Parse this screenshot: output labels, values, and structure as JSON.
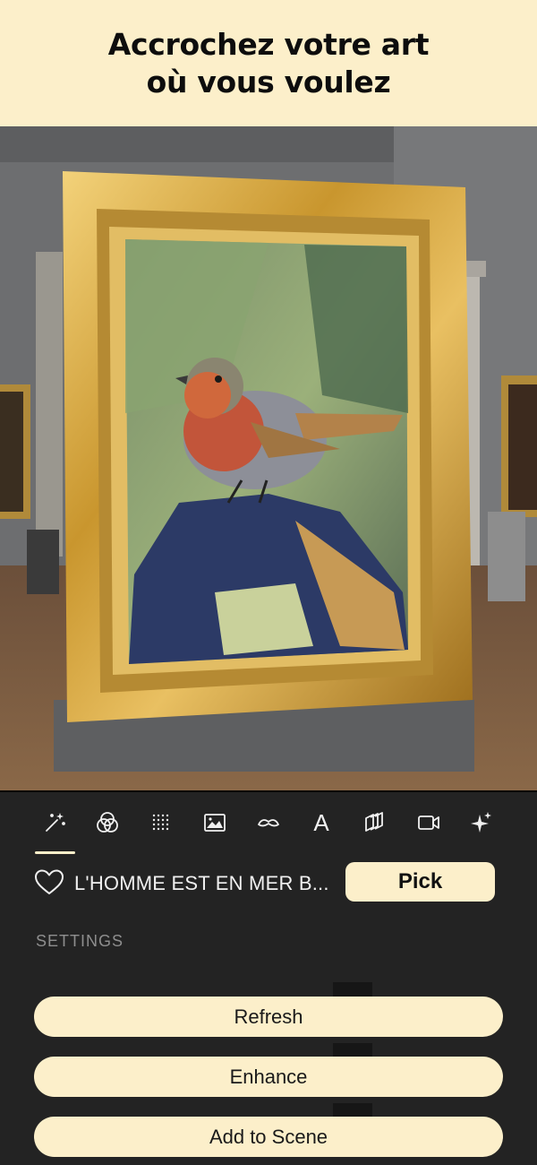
{
  "banner": {
    "line1": "Accrochez votre art",
    "line2": "où vous voulez",
    "background": "#fcefca"
  },
  "scene": {
    "image": "bird-painting-in-gold-frame-museum"
  },
  "toolbar": {
    "items": [
      {
        "icon": "magic-wand-icon",
        "selected": true
      },
      {
        "icon": "color-circles-icon"
      },
      {
        "icon": "dot-grid-icon"
      },
      {
        "icon": "image-icon"
      },
      {
        "icon": "mustache-icon"
      },
      {
        "icon": "text-icon",
        "glyph": "A"
      },
      {
        "icon": "layers-icon"
      },
      {
        "icon": "video-camera-icon"
      },
      {
        "icon": "sparkles-icon"
      }
    ]
  },
  "artwork": {
    "title": "L'HOMME EST EN MER B...",
    "pick_label": "Pick"
  },
  "settings": {
    "label": "SETTINGS"
  },
  "actions": {
    "refresh": "Refresh",
    "enhance": "Enhance",
    "add_to_scene": "Add to Scene"
  },
  "colors": {
    "accent": "#fcefca",
    "panel": "#232323",
    "text": "#f0f0f0"
  }
}
